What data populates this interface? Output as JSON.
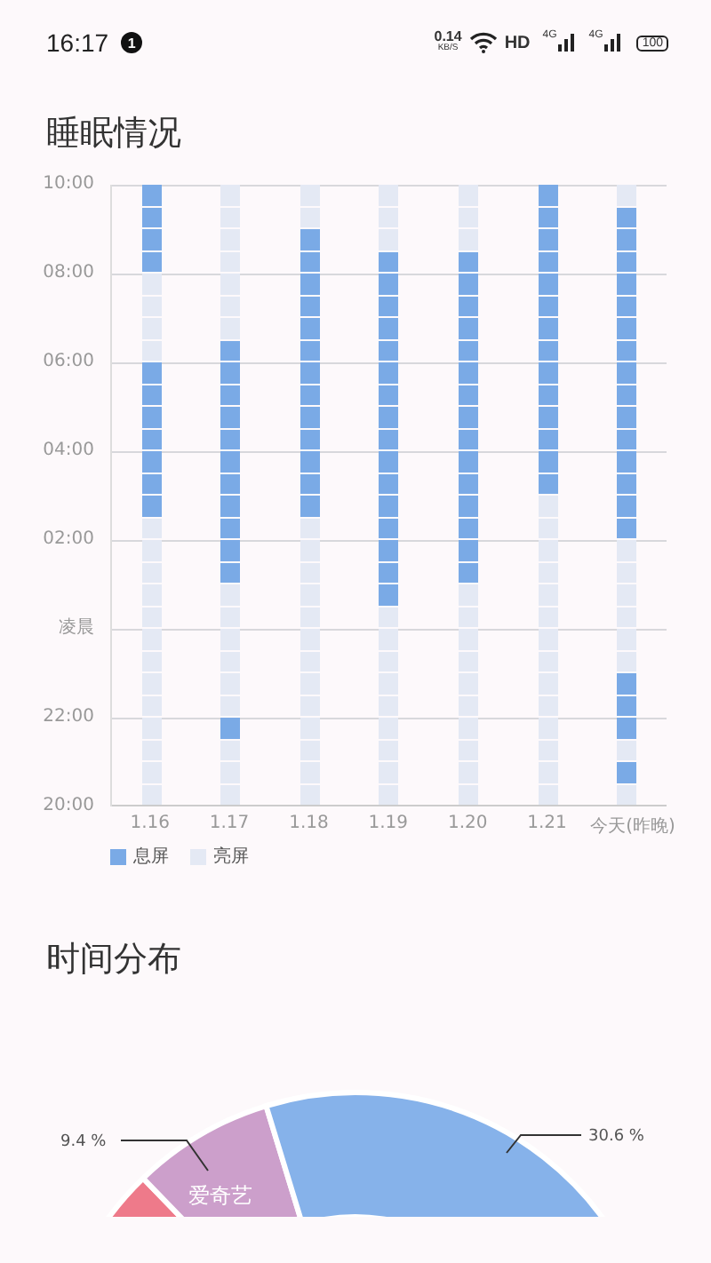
{
  "status_bar": {
    "time": "16:17",
    "notification_count": "1",
    "net_speed": "0.14",
    "net_unit": "KB/S",
    "hd": "HD",
    "signals": [
      "4G",
      "4G"
    ],
    "battery": "100"
  },
  "sleep": {
    "title": "睡眠情况",
    "y_labels": [
      "10:00",
      "08:00",
      "06:00",
      "04:00",
      "02:00",
      "凌晨",
      "22:00",
      "20:00"
    ],
    "days": [
      {
        "label": "1.16",
        "screen_off": [
          true,
          true,
          true,
          true,
          false,
          false,
          false,
          false,
          true,
          true,
          true,
          true,
          true,
          true,
          true,
          false,
          false,
          false,
          false,
          false,
          false,
          false,
          false,
          false,
          false,
          false,
          false,
          false
        ]
      },
      {
        "label": "1.17",
        "screen_off": [
          false,
          false,
          false,
          false,
          false,
          false,
          false,
          true,
          true,
          true,
          true,
          true,
          true,
          true,
          true,
          true,
          true,
          true,
          false,
          false,
          false,
          false,
          false,
          false,
          true,
          false,
          false,
          false
        ]
      },
      {
        "label": "1.18",
        "screen_off": [
          false,
          false,
          true,
          true,
          true,
          true,
          true,
          true,
          true,
          true,
          true,
          true,
          true,
          true,
          true,
          false,
          false,
          false,
          false,
          false,
          false,
          false,
          false,
          false,
          false,
          false,
          false,
          false
        ]
      },
      {
        "label": "1.19",
        "screen_off": [
          false,
          false,
          false,
          true,
          true,
          true,
          true,
          true,
          true,
          true,
          true,
          true,
          true,
          true,
          true,
          true,
          true,
          true,
          true,
          false,
          false,
          false,
          false,
          false,
          false,
          false,
          false,
          false
        ]
      },
      {
        "label": "1.20",
        "screen_off": [
          false,
          false,
          false,
          true,
          true,
          true,
          true,
          true,
          true,
          true,
          true,
          true,
          true,
          true,
          true,
          true,
          true,
          true,
          false,
          false,
          false,
          false,
          false,
          false,
          false,
          false,
          false,
          false
        ]
      },
      {
        "label": "1.21",
        "screen_off": [
          true,
          true,
          true,
          true,
          true,
          true,
          true,
          true,
          true,
          true,
          true,
          true,
          true,
          true,
          false,
          false,
          false,
          false,
          false,
          false,
          false,
          false,
          false,
          false,
          false,
          false,
          false,
          false
        ]
      },
      {
        "label": "今天(昨晚)",
        "screen_off": [
          false,
          true,
          true,
          true,
          true,
          true,
          true,
          true,
          true,
          true,
          true,
          true,
          true,
          true,
          true,
          true,
          false,
          false,
          false,
          false,
          false,
          false,
          true,
          true,
          true,
          false,
          true,
          false
        ]
      }
    ],
    "legend": [
      {
        "label": "息屏",
        "color": "#7aaae6"
      },
      {
        "label": "亮屏",
        "color": "#e4e9f4"
      }
    ]
  },
  "distribution": {
    "title": "时间分布",
    "slices": [
      {
        "color": "#ee7a8a"
      },
      {
        "color": "#cc9fcb",
        "label": "爱奇艺",
        "percent": "9.4 %"
      },
      {
        "color": "#86b2ea",
        "percent": "30.6 %"
      }
    ]
  }
}
